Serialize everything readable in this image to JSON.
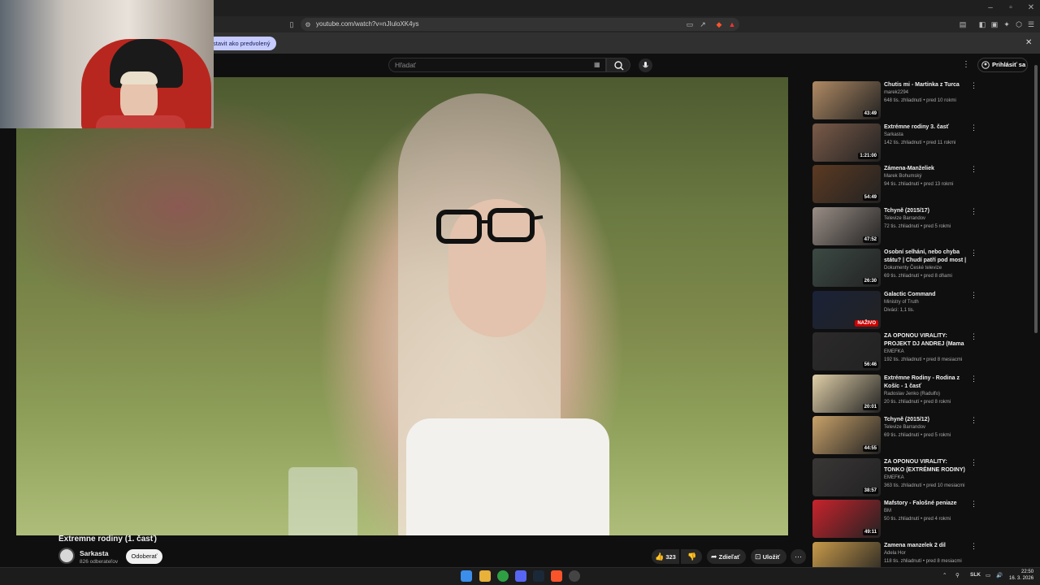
{
  "browser": {
    "url": "youtube.com/watch?v=nJIuloXK4ys",
    "infobar_button": "stavit ako predvolený",
    "window_controls": [
      "–",
      "▫",
      "✕"
    ]
  },
  "header": {
    "search_placeholder": "Hľadať",
    "signin_label": "Prihlásiť sa"
  },
  "video": {
    "title": "Extremne rodiny (1. časť)",
    "channel": "Sarkasta",
    "subscribers": "826 odberateľov",
    "subscribe_label": "Odoberať",
    "likes": "323",
    "share_label": "Zdieľať",
    "save_label": "Uložiť"
  },
  "sidebar": {
    "items": [
      {
        "title": "Chutis mi - Martinka z Turca",
        "channel": "marek2294",
        "meta": "648 tis. zhliadnutí • pred 10 rokmi",
        "duration": "43:49",
        "color": "#b08a64"
      },
      {
        "title": "Extrémne rodiny 3. časť",
        "channel": "Sarkasta",
        "meta": "142 tis. zhliadnutí • pred 11 rokmi",
        "duration": "1:21:00",
        "color": "#7a5a48"
      },
      {
        "title": "Zámena-Manželiek",
        "channel": "Marek Bohumský",
        "meta": "94 tis. zhliadnutí • pred 13 rokmi",
        "duration": "54:49",
        "color": "#5c3a22"
      },
      {
        "title": "Tchyně (2015/17)",
        "channel": "Televize Barrandov",
        "meta": "72 tis. zhliadnutí • pred 5 rokmi",
        "duration": "47:52",
        "color": "#9a8e86"
      },
      {
        "title": "Osobní selhání, nebo chyba státu? | Chudí patří pod most | ...",
        "channel": "Dokumenty České televize",
        "meta": "69 tis. zhliadnutí • pred 8 dňami",
        "duration": "26:30",
        "color": "#3c4a44"
      },
      {
        "title": "Galactic Command",
        "channel": "Ministry of Truth",
        "meta": "Diváci: 1,1 tis.",
        "duration": "NAŽIVO",
        "color": "#1a2238"
      },
      {
        "title": "ZA OPONOU VIRALITY: PROJEKT DJ ANDREJ (Mama ...",
        "channel": "EMEFKA",
        "meta": "192 tis. zhliadnutí • pred 8 mesiacmi",
        "duration": "56:46",
        "color": "#2c2a2a"
      },
      {
        "title": "Extrémne Rodiny - Rodina z Košíc - 1 časť",
        "channel": "Radoslav Jenko (Radulfo)",
        "meta": "20 tis. zhliadnutí • pred 8 rokmi",
        "duration": "20:01",
        "color": "#e0cfa8"
      },
      {
        "title": "Tchyně (2015/12)",
        "channel": "Televize Barrandov",
        "meta": "69 tis. zhliadnutí • pred 5 rokmi",
        "duration": "44:55",
        "color": "#c9a26a"
      },
      {
        "title": "ZA OPONOU VIRALITY: TONKO (EXTRÉMNE RODINY)",
        "channel": "EMEFKA",
        "meta": "363 tis. zhliadnutí • pred 10 mesiacmi",
        "duration": "38:57",
        "color": "#3a3636"
      },
      {
        "title": "Mafstory - Falošné peniaze",
        "channel": "BM",
        "meta": "50 tis. zhliadnutí • pred 4 rokmi",
        "duration": "49:11",
        "color": "#c8232c"
      },
      {
        "title": "Zamena manzelek 2 dil",
        "channel": "Adela Hor",
        "meta": "118 tis. zhliadnutí • pred 8 mesiacmi",
        "duration": "",
        "color": "#c89a4a"
      }
    ]
  },
  "taskbar": {
    "lang": "SLK",
    "time": "22:50",
    "date": "16. 3. 2026"
  }
}
